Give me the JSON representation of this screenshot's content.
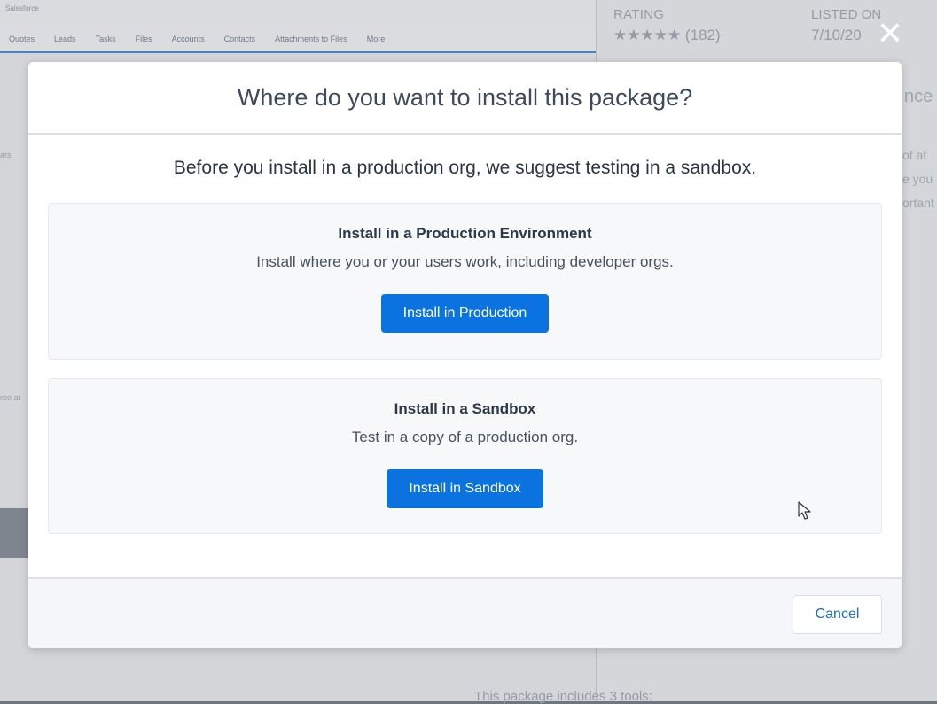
{
  "background": {
    "app_label": "Salesforce",
    "nav_items": [
      "Quotes",
      "Leads",
      "Tasks",
      "Files",
      "Accounts",
      "Contacts",
      "Attachments to Files",
      "More"
    ],
    "rating_label": "RATING",
    "rating_value": "★★★★★ (182)",
    "listed_label": "LISTED ON",
    "listed_value": "7/10/20",
    "side_fragment_1": "nce",
    "side_fragment_2": "of at\ne you\nortant",
    "left_fragment_1": "ars",
    "left_fragment_2": "ree at",
    "bottom_fragment": "This package includes 3 tools:"
  },
  "close_button": {
    "icon": "close-icon",
    "glyph": "✕"
  },
  "modal": {
    "title": "Where do you want to install this package?",
    "subtitle": "Before you install in a production org, we suggest testing in a sandbox.",
    "options": [
      {
        "title": "Install in a Production Environment",
        "description": "Install where you or your users work, including developer orgs.",
        "button_label": "Install in Production"
      },
      {
        "title": "Install in a Sandbox",
        "description": "Test in a copy of a production org.",
        "button_label": "Install in Sandbox"
      }
    ],
    "cancel_label": "Cancel"
  },
  "colors": {
    "primary": "#0b73e0",
    "link": "#1f6cc6",
    "title_text": "#3e4a5a"
  }
}
